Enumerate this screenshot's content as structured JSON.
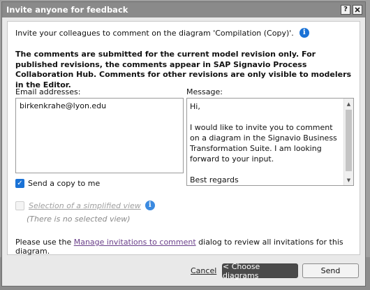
{
  "dialog": {
    "title": "Invite anyone for feedback",
    "help_label": "?",
    "close_label": "X"
  },
  "intro": {
    "text": "Invite your colleagues to comment on the diagram 'Compilation (Copy)'.",
    "icon": "info-icon"
  },
  "notice": "The comments are submitted for the current model revision only. For published revisions, the comments appear in SAP Signavio Process Collaboration Hub. Comments for other revisions are only visible to modelers in the Editor.",
  "email": {
    "label": "Email addresses:",
    "value": "birkenkrahe@lyon.edu"
  },
  "message": {
    "label": "Message:",
    "value": "Hi,\n\nI would like to invite you to comment on a diagram in the Signavio Business Transformation Suite. I am looking forward to your input.\n\nBest regards"
  },
  "send_copy": {
    "label": "Send a copy to me",
    "checked": true
  },
  "simplified_view": {
    "label": "Selection of a simplified view",
    "status": "(There is no selected view)",
    "enabled": false
  },
  "footer": {
    "before": "Please use the ",
    "link": "Manage invitations to comment",
    "after": " dialog to review all invitations for this diagram."
  },
  "actions": {
    "cancel": "Cancel",
    "choose": "< Choose diagrams",
    "send": "Send"
  },
  "colors": {
    "accent": "#1a72d6",
    "titlebar": "#8a8a8a",
    "link_visited": "#6a3f8a"
  }
}
